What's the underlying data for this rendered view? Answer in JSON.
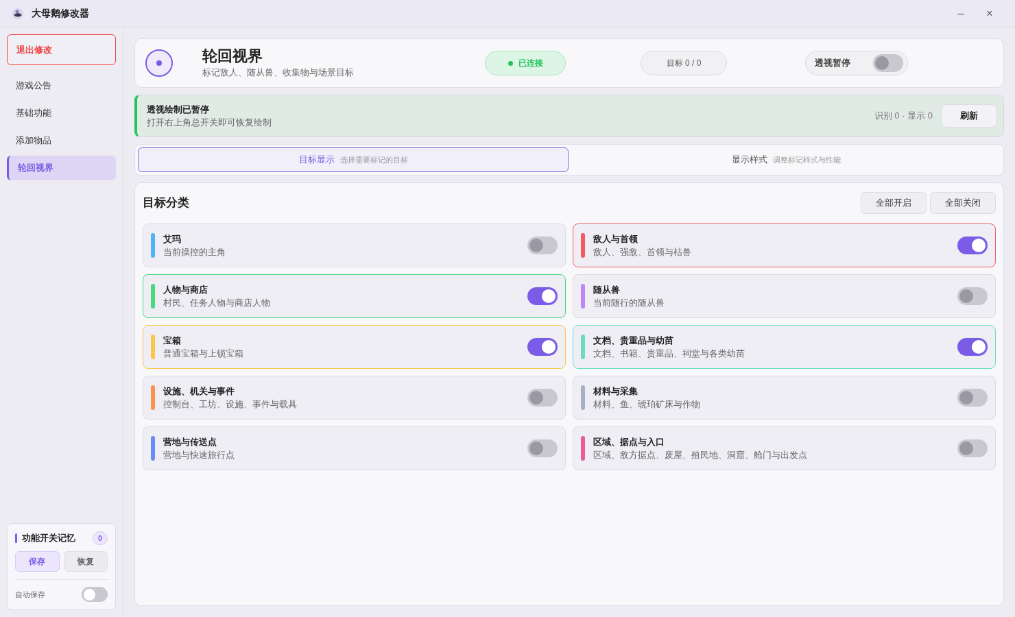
{
  "window": {
    "title": "大母鹅修改器",
    "controls": [
      "–",
      "×"
    ]
  },
  "sidebar": {
    "items": [
      {
        "label": "退出修改",
        "kind": "danger",
        "selected": false
      },
      {
        "label": "游戏公告",
        "kind": "nav",
        "selected": false
      },
      {
        "label": "基础功能",
        "kind": "nav",
        "selected": false
      },
      {
        "label": "添加物品",
        "kind": "nav",
        "selected": false
      },
      {
        "label": "轮回视界",
        "kind": "nav",
        "selected": true
      }
    ],
    "memory": {
      "title": "功能开关记忆",
      "count": "0",
      "buttons": [
        {
          "label": "保存",
          "selected": true
        },
        {
          "label": "恢复",
          "selected": false
        }
      ],
      "auto_save": {
        "label": "自动保存",
        "on": false
      }
    }
  },
  "header": {
    "title": "轮回视界",
    "subtitle": "标记敌人、随从兽、收集物与场景目标",
    "status": {
      "label": "已连接",
      "connected": true
    },
    "target_count": "目标 0 / 0",
    "master": {
      "label": "透视暂停",
      "on": false
    }
  },
  "notice": {
    "title": "透视绘制已暂停",
    "text": "打开右上角总开关即可恢复绘制",
    "stats": "识别 0 · 显示 0",
    "button": "刷新"
  },
  "tabs": [
    {
      "label": "目标显示",
      "hint": "选择需要标记的目标",
      "selected": true
    },
    {
      "label": "显示样式",
      "hint": "调整标记样式与性能",
      "selected": false
    }
  ],
  "panel": {
    "title": "目标分类",
    "buttons": [
      "全部开启",
      "全部关闭"
    ],
    "categories": [
      {
        "name": "艾玛",
        "desc": "当前操控的主角",
        "color": "#4fb3f6",
        "on": false
      },
      {
        "name": "敌人与首领",
        "desc": "敌人、强敌、首领与枯兽",
        "color": "#f05a64",
        "on": true
      },
      {
        "name": "人物与商店",
        "desc": "村民、任务人物与商店人物",
        "color": "#4cd680",
        "on": true
      },
      {
        "name": "随从兽",
        "desc": "当前随行的随从兽",
        "color": "#c084fc",
        "on": false
      },
      {
        "name": "宝箱",
        "desc": "普通宝箱与上锁宝箱",
        "color": "#fbc64a",
        "on": true
      },
      {
        "name": "文档、贵重品与幼苗",
        "desc": "文档、书籍、贵重品、祠堂与各类幼苗",
        "color": "#6ddbc0",
        "on": true
      },
      {
        "name": "设施、机关与事件",
        "desc": "控制台、工坊、设施、事件与载具",
        "color": "#fb9350",
        "on": false
      },
      {
        "name": "材料与采集",
        "desc": "材料、鱼、琥珀矿床与作物",
        "color": "#a8b0bf",
        "on": false
      },
      {
        "name": "营地与传送点",
        "desc": "营地与快速旅行点",
        "color": "#6b8cf7",
        "on": false
      },
      {
        "name": "区域、据点与入口",
        "desc": "区域、敌方据点、废屋、殖民地、洞窟、舱门与出发点",
        "color": "#ec5a9a",
        "on": false
      }
    ]
  }
}
